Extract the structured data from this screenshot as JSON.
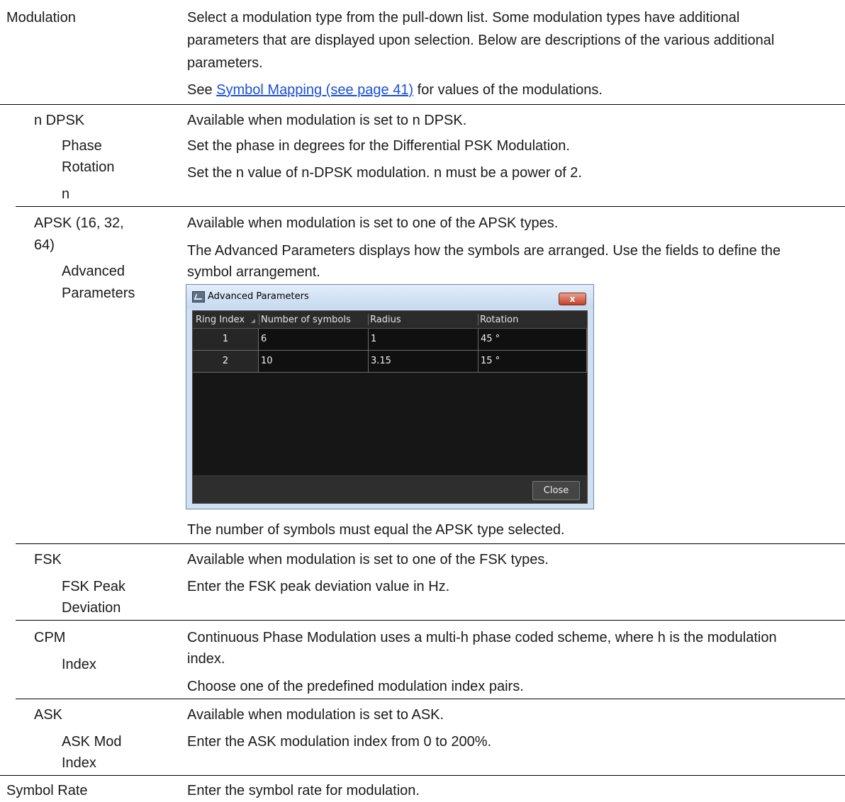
{
  "modulation": {
    "term": "Modulation",
    "desc_lines": [
      "Select a modulation type from the pull-down list.  Some modulation types have additional",
      "parameters that are displayed upon selection.  Below are descriptions of the various additional",
      "parameters."
    ],
    "see_prefix": "See ",
    "see_link": "Symbol Mapping (see page 41)",
    "see_suffix": " for values of the modulations."
  },
  "ndpsk": {
    "term": "n DPSK",
    "desc": "Available when modulation is set to n DPSK.",
    "phase_rotation_label": [
      "Phase",
      "Rotation"
    ],
    "phase_rotation_desc": "Set the phase in degrees for the Differential PSK Modulation.",
    "n_label": "n",
    "n_desc": "Set the n value of n-DPSK modulation.  n must be a power of 2."
  },
  "apsk": {
    "term_lines": [
      "APSK (16, 32,",
      "64)"
    ],
    "desc": "Available when modulation is set to one of the APSK types.",
    "adv_label": [
      "Advanced",
      "Parameters"
    ],
    "adv_desc_lines": [
      "The Advanced Parameters displays how the symbols are arranged.  Use the fields to define the",
      "symbol arrangement."
    ],
    "after": "The number of symbols must equal the APSK type selected."
  },
  "dialog": {
    "title": "Advanced Parameters",
    "close_x": "x",
    "columns": [
      "Ring Index",
      "Number of symbols",
      "Radius",
      "Rotation"
    ],
    "rows": [
      [
        "1",
        "6",
        "1",
        "45 °"
      ],
      [
        "2",
        "10",
        "3.15",
        "15 °"
      ]
    ],
    "close_button": "Close"
  },
  "fsk": {
    "term": "FSK",
    "desc": "Available when modulation is set to one of the FSK types.",
    "peak_label": [
      "FSK Peak",
      "Deviation"
    ],
    "peak_desc": "Enter the FSK peak deviation value in Hz."
  },
  "cpm": {
    "term": "CPM",
    "index_label": "Index",
    "desc_lines": [
      "Continuous Phase Modulation uses a multi-h phase coded scheme, where h is the modulation",
      "index."
    ],
    "desc2": "Choose one of the predefined modulation index pairs."
  },
  "ask": {
    "term": "ASK",
    "desc": "Available when modulation is set to ASK.",
    "mod_label": [
      "ASK Mod",
      "Index"
    ],
    "mod_desc": "Enter the ASK modulation index from 0 to 200%."
  },
  "symbol_rate": {
    "term": "Symbol Rate",
    "desc": "Enter the symbol rate for modulation."
  }
}
